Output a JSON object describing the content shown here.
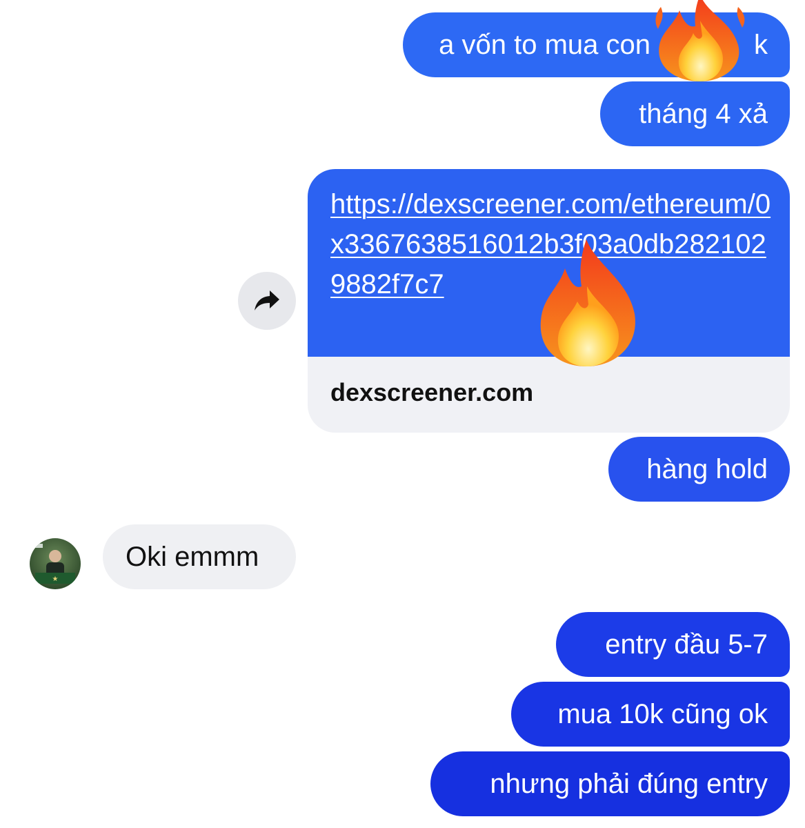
{
  "messages": {
    "outgoing": [
      "a vốn to mua con",
      "tháng 4 xả",
      "hàng hold",
      "entry đầu 5-7",
      "mua 10k cũng ok",
      "nhưng phải đúng entry"
    ],
    "b1_tail": "k"
  },
  "link_preview": {
    "url": "https://dexscreener.com/ethereum/0x3367638516012b3f03a0db2821029882f7c7",
    "domain": "dexscreener.com"
  },
  "incoming": {
    "text": "Oki emmm"
  },
  "icons": {
    "share": "share-arrow-icon",
    "fire": "fire-emoji-icon",
    "avatar": "contact-avatar"
  },
  "colors": {
    "bubble_blue_top": "#2d69f4",
    "bubble_blue_bottom": "#1630e0",
    "incoming_bg": "#eff0f3",
    "link_footer_bg": "#f0f1f5"
  }
}
